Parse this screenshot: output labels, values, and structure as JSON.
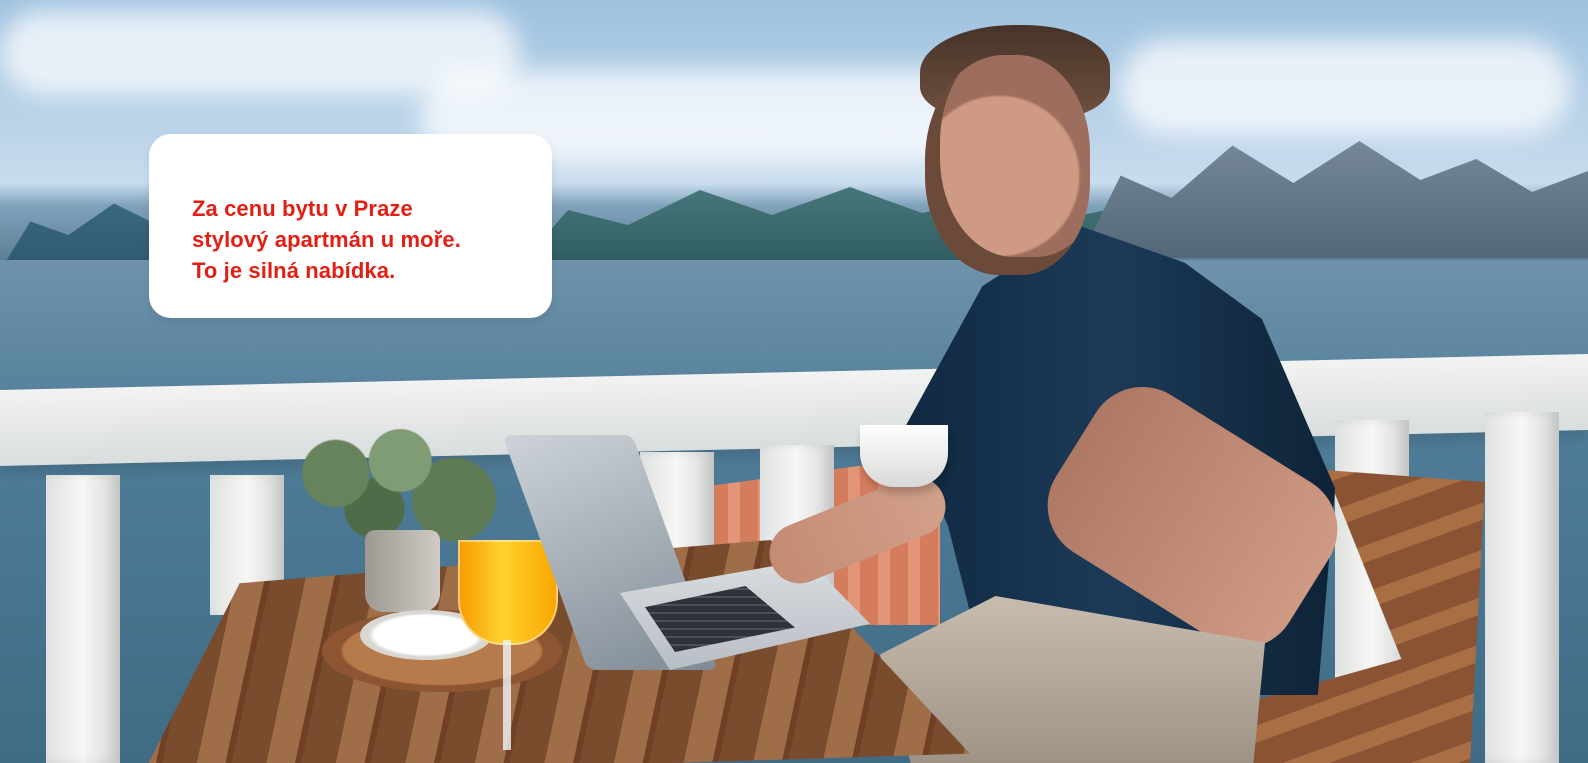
{
  "hero": {
    "headline_lines": [
      "Za cenu bytu v Praze",
      "stylový apartmán u moře.",
      "To je silná nabídka."
    ]
  },
  "colors": {
    "accent": "#e31e13",
    "card_background": "#ffffff"
  }
}
